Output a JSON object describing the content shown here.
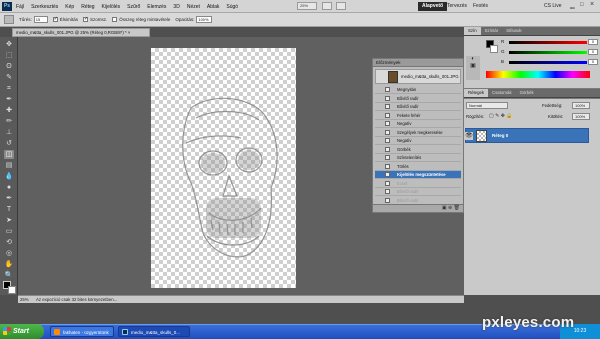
{
  "menubar": {
    "logo": "Ps",
    "menus": [
      "Fájl",
      "Szerkesztés",
      "Kép",
      "Réteg",
      "Kijelölés",
      "Szűrő",
      "Elemzés",
      "3D",
      "Nézet",
      "Ablak",
      "Súgó"
    ],
    "zoom": "25%",
    "workspaces": {
      "active": "Alapvető",
      "others": [
        "Tervezés",
        "Festés"
      ]
    },
    "cslive": "CS Live"
  },
  "options": {
    "tolerance_label": "Tűrés:",
    "tolerance_value": "15",
    "antialias_label": "Élsimítás",
    "contiguous_label": "Szomsz.",
    "all_layers_label": "Összeg réteg mintavétele",
    "opacity_label": "Opacitás:",
    "opacity_value": "100%"
  },
  "document": {
    "tab_title": "medio_m&tta_skulls_001.JPG @ 25% (Réteg 0,RGB/8*) * ×"
  },
  "history": {
    "title": "Előzmények",
    "snapshot": "medio_m&tta_skulls_001.JPG",
    "items": [
      {
        "label": "Megnyitás",
        "state": "normal"
      },
      {
        "label": "Bővítő radír",
        "state": "normal"
      },
      {
        "label": "Bővítő radír",
        "state": "normal"
      },
      {
        "label": "Fekete fehér",
        "state": "normal"
      },
      {
        "label": "Negatív",
        "state": "normal"
      },
      {
        "label": "Szegélyek megkeresése",
        "state": "normal"
      },
      {
        "label": "Negatív",
        "state": "normal"
      },
      {
        "label": "Görbék",
        "state": "normal"
      },
      {
        "label": "Színtelenítés",
        "state": "normal"
      },
      {
        "label": "Törlés",
        "state": "normal"
      },
      {
        "label": "Kijelölés megszüntetése",
        "state": "current"
      },
      {
        "label": "Ecset",
        "state": "dim"
      },
      {
        "label": "Bővítő radír",
        "state": "dim"
      },
      {
        "label": "Bővítő radír",
        "state": "dim"
      }
    ]
  },
  "color_panel": {
    "tabs": [
      "Szín",
      "Színtár",
      "Stílusok"
    ],
    "r_label": "R",
    "g_label": "G",
    "b_label": "B",
    "r": "0",
    "g": "0",
    "b": "0"
  },
  "layers_panel": {
    "tabs": [
      "Rétegek",
      "Csatornák",
      "Görbék"
    ],
    "blend_mode": "Normál",
    "opacity_label": "Fedettség:",
    "opacity": "100%",
    "lock_label": "Rögzítés:",
    "fill_label": "Kitöltés:",
    "fill": "100%",
    "layer_name": "Réteg 0"
  },
  "status": {
    "zoom": "25%",
    "info": "Az expozíció csak 32 bites környezetben..."
  },
  "taskbar": {
    "start": "Start",
    "tasks": [
      "fakhaten - üzgyerütünk",
      "medio_m&tta_skulls_0..."
    ],
    "time": "10:23"
  },
  "watermark": "pxleyes.com",
  "colors": {
    "accent": "#3b73b9",
    "workspace": "#606060",
    "taskbar": "#1f4fbf"
  }
}
